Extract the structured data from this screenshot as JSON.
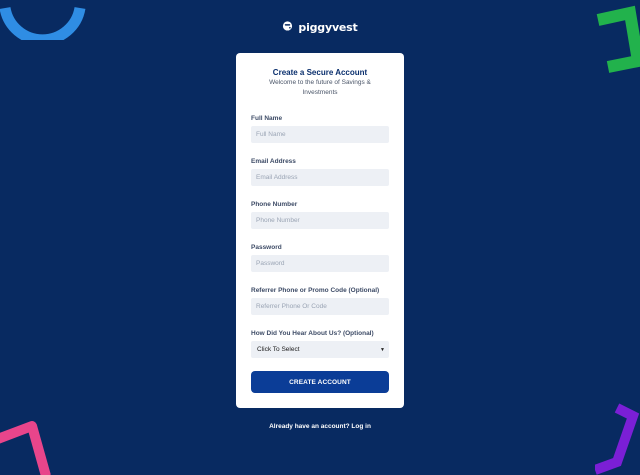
{
  "brand": {
    "name": "piggyvest",
    "logo_icon": "piggy-logo-icon"
  },
  "form": {
    "title": "Create a Secure Account",
    "subtitle": "Welcome to the future of Savings & Investments",
    "fields": [
      {
        "label": "Full Name",
        "placeholder": "Full Name",
        "value": ""
      },
      {
        "label": "Email Address",
        "placeholder": "Email Address",
        "value": ""
      },
      {
        "label": "Phone Number",
        "placeholder": "Phone Number",
        "value": ""
      },
      {
        "label": "Password",
        "placeholder": "Password",
        "value": ""
      },
      {
        "label": "Referrer Phone or Promo Code (Optional)",
        "placeholder": "Referrer Phone Or Code",
        "value": ""
      }
    ],
    "hear_about": {
      "label": "How Did You Hear About Us? (Optional)",
      "selected": "Click To Select",
      "caret_icon": "caret-down-icon"
    },
    "submit_label": "CREATE ACCOUNT"
  },
  "footer": {
    "login_text": "Already have an account? Log in"
  },
  "colors": {
    "background": "#082a61",
    "card": "#ffffff",
    "primary_button": "#0b3d97",
    "input_bg": "#edf0f5",
    "deco_blue": "#2f8de4",
    "deco_green": "#22b24c",
    "deco_pink": "#e8458b",
    "deco_purple": "#7b1fd6"
  }
}
